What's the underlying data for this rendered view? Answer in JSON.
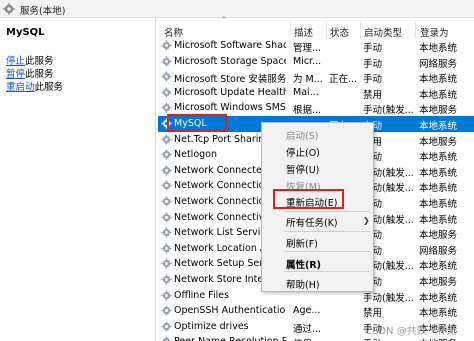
{
  "window": {
    "title": "服务(本地)"
  },
  "left_pane": {
    "service_name": "MySQL",
    "actions": [
      {
        "link": "停止",
        "suffix": "此服务"
      },
      {
        "link": "暂停",
        "suffix": "此服务"
      },
      {
        "link": "重启动",
        "suffix": "此服务"
      }
    ]
  },
  "columns": {
    "name": "名称",
    "description": "描述",
    "status": "状态",
    "startup_type": "启动类型",
    "logon_as": "登录为"
  },
  "services": [
    {
      "name": "Microsoft Software Shad...",
      "description": "管理...",
      "status": "",
      "startup": "手动",
      "logon": "本地系统"
    },
    {
      "name": "Microsoft Storage Space...",
      "description": "Micr...",
      "status": "",
      "startup": "手动",
      "logon": "网络服务"
    },
    {
      "name": "Microsoft Store 安装服务",
      "description": "为 M...",
      "status": "正在...",
      "startup": "手动",
      "logon": "本地系统"
    },
    {
      "name": "Microsoft Update Health...",
      "description": "Mai...",
      "status": "",
      "startup": "禁用",
      "logon": "本地系统"
    },
    {
      "name": "Microsoft Windows SMS ...",
      "description": "根据...",
      "status": "",
      "startup": "手动(触发...",
      "logon": "本地服务"
    },
    {
      "name": "MySQL",
      "description": "",
      "status": "正在...",
      "startup": "自动",
      "logon": "本地系统",
      "selected": true
    },
    {
      "name": "Net.Tcp Port Sharing",
      "description": "",
      "status": "",
      "startup": "禁用",
      "logon": "本地服务"
    },
    {
      "name": "Netlogon",
      "description": "",
      "status": "",
      "startup": "手动",
      "logon": "本地系统"
    },
    {
      "name": "Network Connected",
      "description": "",
      "status": "",
      "startup": "手动(触发...",
      "logon": "本地系统"
    },
    {
      "name": "Network Connection",
      "description": "",
      "status": "",
      "startup": "手动(触发...",
      "logon": "本地系统"
    },
    {
      "name": "Network Connection",
      "description": "",
      "status": "",
      "startup": "手动",
      "logon": "本地系统"
    },
    {
      "name": "Network Connectivit",
      "description": "",
      "status": "",
      "startup": "手动(触发...",
      "logon": "本地系统"
    },
    {
      "name": "Network List Service",
      "description": "",
      "status": "",
      "startup": "手动",
      "logon": "本地服务"
    },
    {
      "name": "Network Location A",
      "description": "",
      "status": "",
      "startup": "自动",
      "logon": "网络服务"
    },
    {
      "name": "Network Setup Serv",
      "description": "",
      "status": "",
      "startup": "手动(触发...",
      "logon": "本地系统"
    },
    {
      "name": "Network Store Inter",
      "description": "",
      "status": "",
      "startup": "自动",
      "logon": "本地服务"
    },
    {
      "name": "Offline Files",
      "description": "",
      "status": "",
      "startup": "手动(触发...",
      "logon": "本地系统"
    },
    {
      "name": "OpenSSH Authentication ...",
      "description": "Age...",
      "status": "",
      "startup": "禁用",
      "logon": "本地系统"
    },
    {
      "name": "Optimize drives",
      "description": "通过...",
      "status": "",
      "startup": "手动",
      "logon": "本地系统"
    },
    {
      "name": "Peer Name Resolution Pr...",
      "description": "使用...",
      "status": "",
      "startup": "手动",
      "logon": "本地服务"
    }
  ],
  "context_menu": {
    "start": "启动(S)",
    "stop": "停止(O)",
    "pause": "暂停(U)",
    "resume": "恢复(M)",
    "restart": "重新启动(E)",
    "all_tasks": "所有任务(K)",
    "refresh": "刷新(F)",
    "properties": "属性(R)",
    "help": "帮助(H)"
  },
  "watermark": "CSDN @共饮一杯无",
  "colors": {
    "selection": "#0078d7",
    "highlight_box": "#e02020",
    "link": "#1a56c4"
  }
}
